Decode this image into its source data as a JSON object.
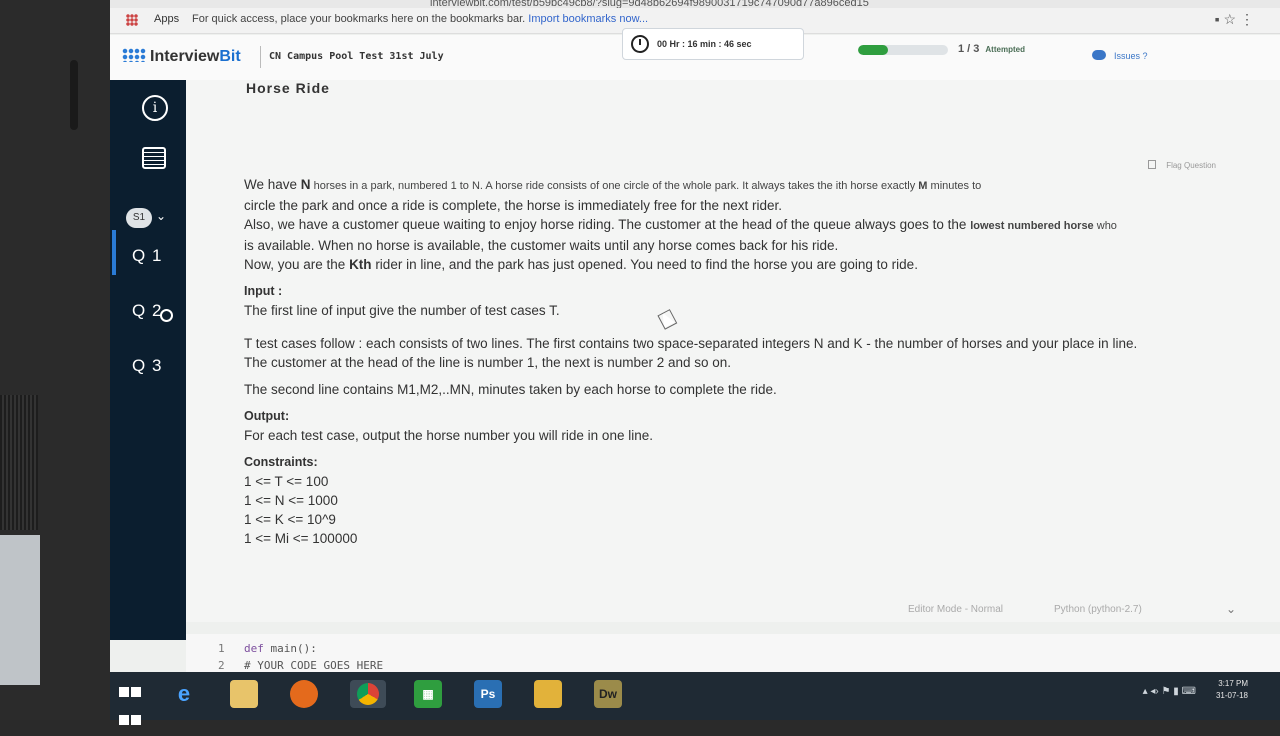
{
  "browser": {
    "url": "interviewbit.com/test/b59bc49cb8/?slug=9d48b62694f9890031719c747090d77a896ced15",
    "bookmarks_apps": "Apps",
    "bookmarks_hint": "For quick access, place your bookmarks here on the bookmarks bar.",
    "bookmarks_import": "Import bookmarks now..."
  },
  "header": {
    "logo_text_a": "Interview",
    "logo_text_b": "Bit",
    "test_name": "CN Campus Pool Test 31st July",
    "timer": "00 Hr : 16 min : 46 sec",
    "progress_fraction": 0.33,
    "attempted_count": "1 / 3",
    "attempted_label": "Attempted",
    "issues": "Issues ?"
  },
  "sidebar": {
    "section_badge": "S1",
    "questions": [
      "Q 1",
      "Q 2",
      "Q 3"
    ]
  },
  "problem": {
    "title": "Horse Ride",
    "flag": "Flag Question",
    "desc_1a": "We have ",
    "desc_1b": "N",
    "desc_1c": " horses in a park, numbered 1 to N. A horse ride consists of one circle of the whole park. It always takes the ith horse exactly ",
    "desc_1d": "M",
    "desc_1e": " minutes to",
    "desc_2": "circle the park and once a ride is complete, the horse is immediately free for the next rider.",
    "desc_3": "Also, we have a customer queue waiting to enjoy horse riding. The customer at the head of the queue always goes to the ",
    "desc_3b": "lowest numbered horse",
    "desc_3c": " who",
    "desc_4": "is available. When no horse is available, the customer waits until any horse comes back for his ride.",
    "desc_5a": "Now, you are the ",
    "desc_5b": "Kth",
    "desc_5c": " rider in line, and the park has just opened. You need to find the horse you are going to ride.",
    "input_heading": "Input :",
    "input_1": "The first line of input give the number of test cases T.",
    "input_2": "T test cases follow : each consists of two lines. The first contains two space-separated integers N and K - the number of horses and your place in line.",
    "input_3": "The customer at the head of the line is number 1, the next is number 2 and so on.",
    "input_4": "The second line contains M1,M2,..MN, minutes taken by each horse to complete the ride.",
    "output_heading": "Output:",
    "output_1": "For each test case, output the horse number you will ride in one line.",
    "constraints_heading": "Constraints:",
    "constraints": [
      "1 <= T <= 100",
      "1 <= N <= 1000",
      "1 <= K <= 10^9",
      "1 <= Mi <= 100000"
    ]
  },
  "editor": {
    "mode": "Editor Mode - Normal",
    "language": "Python (python-2.7)",
    "lines": [
      "1",
      "2"
    ],
    "code": [
      "def main():",
      "    # YOUR CODE GOES HERE"
    ]
  },
  "taskbar": {
    "ps_label": "Ps",
    "dw_label": "Dw",
    "time": "3:17 PM",
    "date": "31-07-18"
  }
}
